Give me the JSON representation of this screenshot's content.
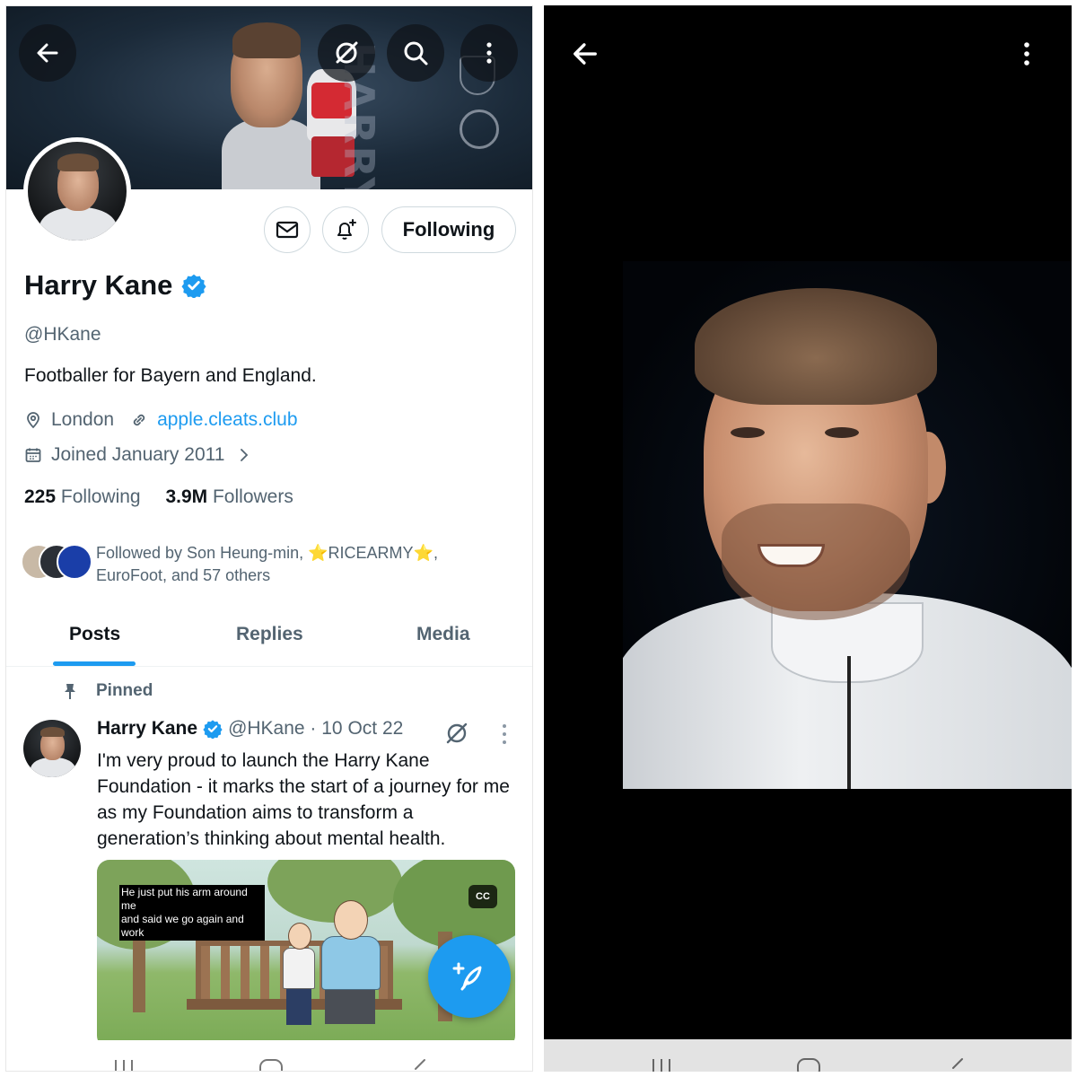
{
  "profile": {
    "name": "Harry Kane",
    "handle": "@HKane",
    "bio": "Footballer for Bayern and England.",
    "location": "London",
    "website": "apple.cleats.club",
    "joined": "Joined January 2011",
    "following_count": "225",
    "following_label": "Following",
    "followers_count": "3.9M",
    "followers_label": "Followers",
    "followed_by_line1": "Followed by Son Heung-min, ⭐RICEARMY⭐,",
    "followed_by_line2": "EuroFoot, and 57 others",
    "follow_button": "Following",
    "banner_text": "HARRY KANE"
  },
  "tabs": [
    {
      "label": "Posts",
      "active": true
    },
    {
      "label": "Replies",
      "active": false
    },
    {
      "label": "Media",
      "active": false
    }
  ],
  "pinned_label": "Pinned",
  "tweet": {
    "name": "Harry Kane",
    "handle_date": "@HKane · 10 Oct 22",
    "text": "I'm very proud to launch the Harry Kane Foundation - it marks the start of a journey for me as my Foundation aims to transform a generation’s thinking about mental health.",
    "video_caption_line1": "He just put his arm around me",
    "video_caption_line2": "and said we go again and work",
    "cc_label": "CC"
  },
  "colors": {
    "accent": "#1d9bf0",
    "text_primary": "#0f1419",
    "text_secondary": "#536471",
    "border": "#cfd9de"
  },
  "icons": {
    "back": "arrow-left-icon",
    "grok": "grok-icon",
    "search": "search-icon",
    "more": "more-vertical-icon",
    "message": "envelope-icon",
    "notify": "bell-plus-icon",
    "verified": "verified-badge-icon",
    "location": "map-pin-icon",
    "link": "link-icon",
    "calendar": "calendar-icon",
    "pin": "pin-icon",
    "compose": "compose-feather-icon"
  }
}
